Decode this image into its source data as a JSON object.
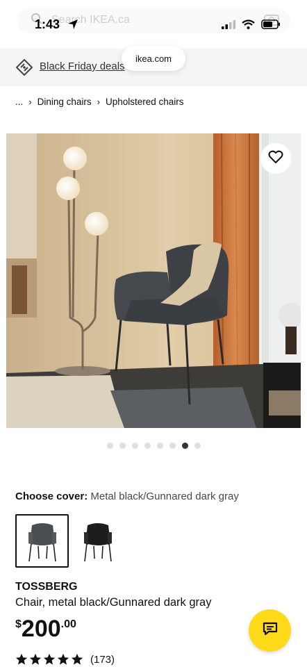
{
  "status_bar": {
    "time": "1:43"
  },
  "search": {
    "placeholder": "Search IKEA.ca"
  },
  "promo": {
    "link_text": "Black Friday deals"
  },
  "url_bar": {
    "domain": "ikea.com"
  },
  "breadcrumb": {
    "ellipsis": "...",
    "items": [
      "Dining chairs",
      "Upholstered chairs"
    ]
  },
  "carousel": {
    "total": 8,
    "active_index": 6
  },
  "cover": {
    "label": "Choose cover:",
    "value": "Metal black/Gunnared dark gray"
  },
  "product": {
    "name": "TOSSBERG",
    "description": "Chair, metal black/Gunnared dark gray",
    "price_currency": "$",
    "price_integer": "200",
    "price_decimal": ".00",
    "rating_count": "(173)",
    "rating_stars": 5
  },
  "colors": {
    "accent": "#ffda1a",
    "text": "#111111",
    "promo_bg": "#f5f5f5"
  }
}
